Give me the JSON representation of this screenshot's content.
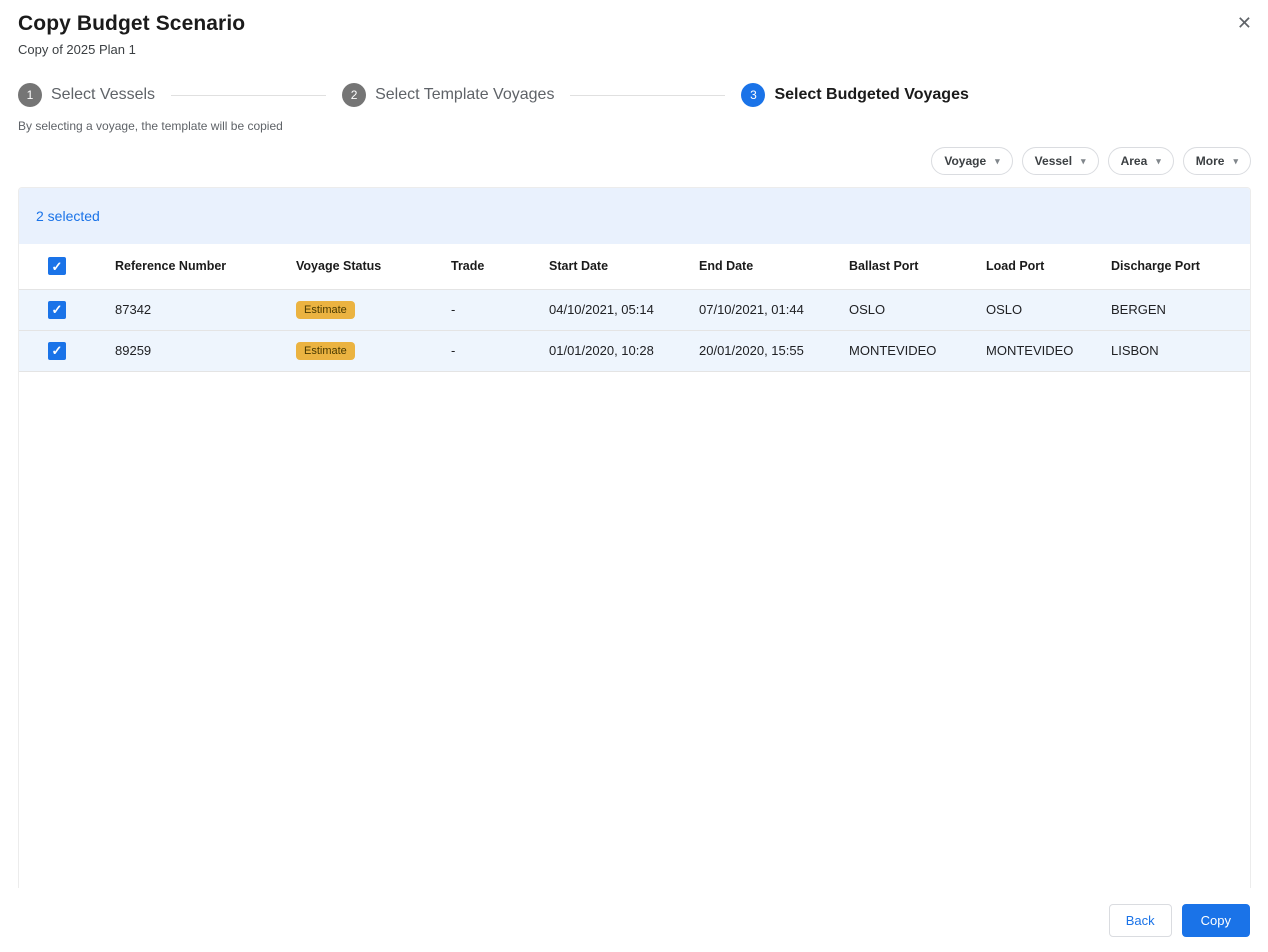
{
  "dialog": {
    "title": "Copy Budget Scenario",
    "subtitle": "Copy of 2025 Plan 1"
  },
  "icons": {
    "close": "✕",
    "chevron_down": "▾",
    "check": "✓"
  },
  "stepper": {
    "steps": [
      {
        "number": "1",
        "label": "Select Vessels",
        "active": false
      },
      {
        "number": "2",
        "label": "Select Template Voyages",
        "active": false
      },
      {
        "number": "3",
        "label": "Select Budgeted Voyages",
        "active": true
      }
    ],
    "helper_text": "By selecting a voyage, the template will be copied"
  },
  "filters": [
    {
      "label": "Voyage"
    },
    {
      "label": "Vessel"
    },
    {
      "label": "Area"
    },
    {
      "label": "More"
    }
  ],
  "table": {
    "selected_count_text": "2 selected",
    "columns": [
      "Reference Number",
      "Voyage Status",
      "Trade",
      "Start Date",
      "End Date",
      "Ballast Port",
      "Load Port",
      "Discharge Port"
    ],
    "rows": [
      {
        "checked": true,
        "reference_number": "87342",
        "voyage_status": "Estimate",
        "trade": "-",
        "start_date": "04/10/2021, 05:14",
        "end_date": "07/10/2021, 01:44",
        "ballast_port": "OSLO",
        "load_port": "OSLO",
        "discharge_port": "BERGEN"
      },
      {
        "checked": true,
        "reference_number": "89259",
        "voyage_status": "Estimate",
        "trade": "-",
        "start_date": "01/01/2020, 10:28",
        "end_date": "20/01/2020, 15:55",
        "ballast_port": "MONTEVIDEO",
        "load_port": "MONTEVIDEO",
        "discharge_port": "LISBON"
      }
    ]
  },
  "footer": {
    "back_label": "Back",
    "copy_label": "Copy"
  },
  "colors": {
    "accent": "#1a73e8",
    "step_inactive": "#757575",
    "selected_row_bg": "#eef5fd",
    "selection_band_bg": "#e9f1fd",
    "badge_bg": "#ebb341",
    "badge_text": "#4a3a00"
  }
}
